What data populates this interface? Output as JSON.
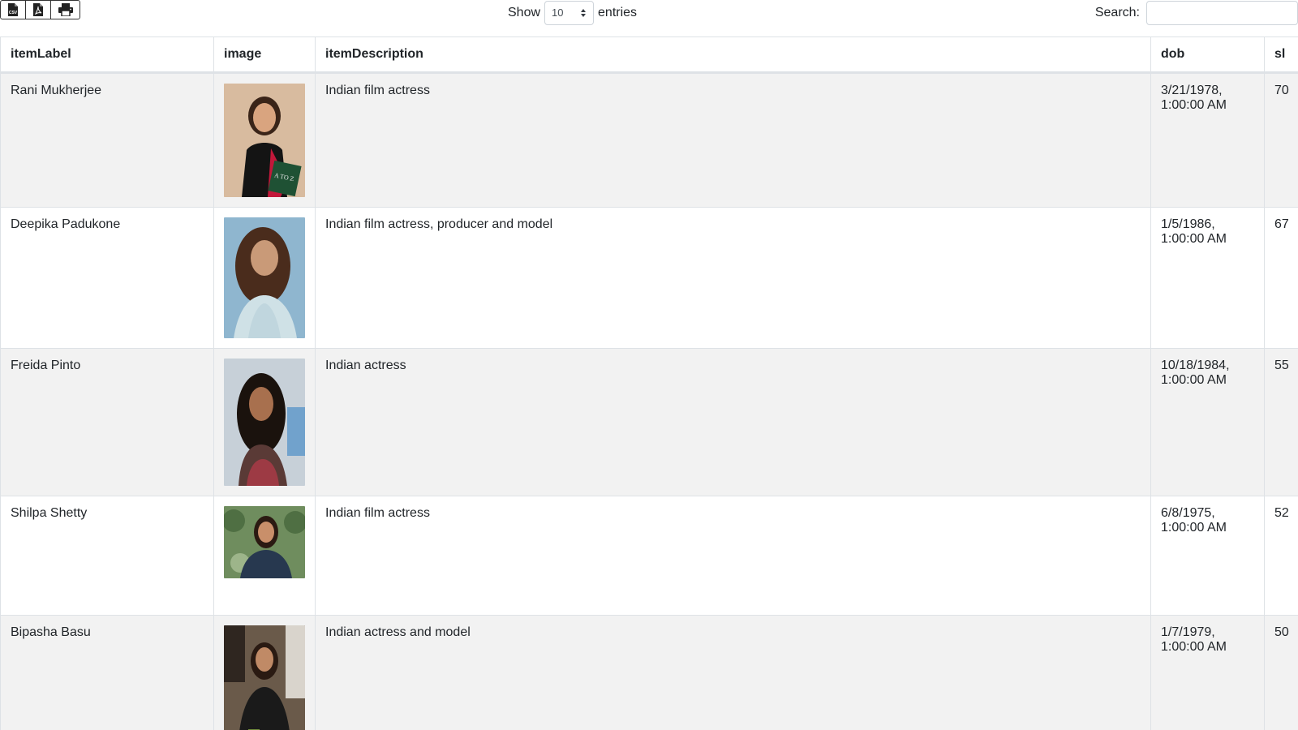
{
  "toolbar": {
    "buttons": [
      {
        "name": "export-csv-button",
        "icon": "csv-file-icon",
        "label": "CSV"
      },
      {
        "name": "export-pdf-button",
        "icon": "pdf-file-icon",
        "label": "PDF"
      },
      {
        "name": "print-button",
        "icon": "printer-icon",
        "label": "Print"
      }
    ]
  },
  "length": {
    "show_label": "Show",
    "selected": "10",
    "entries_label": "entries"
  },
  "search": {
    "label": "Search:",
    "value": "",
    "placeholder": ""
  },
  "table": {
    "columns": [
      "itemLabel",
      "image",
      "itemDescription",
      "dob",
      "sl"
    ],
    "rows": [
      {
        "itemLabel": "Rani Mukherjee",
        "image": "photo",
        "itemDescription": "Indian film actress",
        "dob": "3/21/1978, 1:00:00 AM",
        "sl": "70"
      },
      {
        "itemLabel": "Deepika Padukone",
        "image": "photo",
        "itemDescription": "Indian film actress, producer and model",
        "dob": "1/5/1986, 1:00:00 AM",
        "sl": "67"
      },
      {
        "itemLabel": "Freida Pinto",
        "image": "photo",
        "itemDescription": "Indian actress",
        "dob": "10/18/1984, 1:00:00 AM",
        "sl": "55"
      },
      {
        "itemLabel": "Shilpa Shetty",
        "image": "photo",
        "itemDescription": "Indian film actress",
        "dob": "6/8/1975, 1:00:00 AM",
        "sl": "52"
      },
      {
        "itemLabel": "Bipasha Basu",
        "image": "photo",
        "itemDescription": "Indian actress and model",
        "dob": "1/7/1979, 1:00:00 AM",
        "sl": "50"
      }
    ]
  },
  "colors": {
    "row_striped": "#f2f2f2",
    "border": "#dee2e6",
    "text": "#212529"
  }
}
